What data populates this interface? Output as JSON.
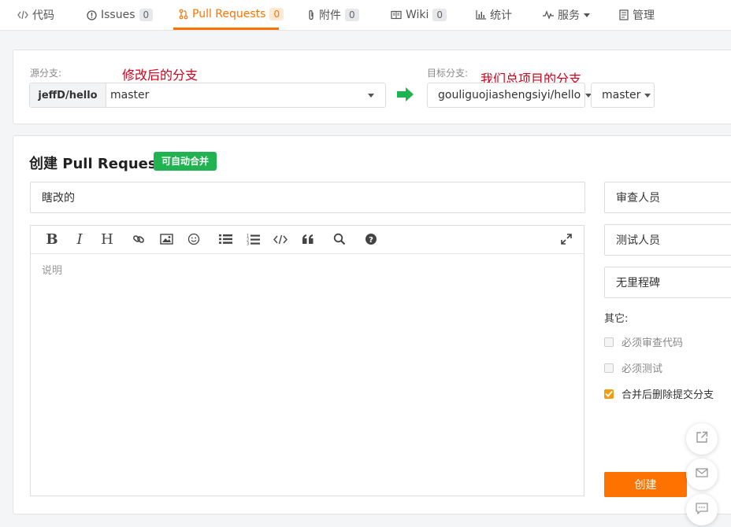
{
  "nav": {
    "tabs": [
      {
        "label": "代码",
        "icon": "code-icon"
      },
      {
        "label": "Issues",
        "count": "0",
        "icon": "issue-icon"
      },
      {
        "label": "Pull Requests",
        "count": "0",
        "icon": "pull-request-icon"
      },
      {
        "label": "附件",
        "count": "0",
        "icon": "paperclip-icon"
      },
      {
        "label": "Wiki",
        "count": "0",
        "icon": "book-icon"
      },
      {
        "label": "统计",
        "icon": "bar-chart-icon"
      },
      {
        "label": "服务",
        "icon": "pulse-icon"
      },
      {
        "label": "管理",
        "icon": "manage-icon"
      }
    ]
  },
  "branches": {
    "source_label": "源分支:",
    "source_annotation": "修改后的分支",
    "source_repo": "jeffD/hello",
    "source_branch": "master",
    "target_label": "目标分支:",
    "target_annotation": "我们总项目的分支",
    "target_repo": "gouliguojiashengsiyi/hello",
    "target_branch": "master"
  },
  "form": {
    "heading": "创建 Pull Request",
    "merge_badge": "可自动合并",
    "title_value": "瞎改的",
    "description_placeholder": "说明"
  },
  "sidebar": {
    "reviewers": "审查人员",
    "testers": "测试人员",
    "milestone": "无里程碑",
    "others_label": "其它:",
    "options": [
      {
        "label": "必须审查代码",
        "checked": false
      },
      {
        "label": "必须测试",
        "checked": false
      },
      {
        "label": "合并后删除提交分支",
        "checked": true
      }
    ],
    "create_button": "创建"
  },
  "colors": {
    "accent": "#fe7300",
    "success": "#21b351",
    "annotation": "#d0021b"
  }
}
